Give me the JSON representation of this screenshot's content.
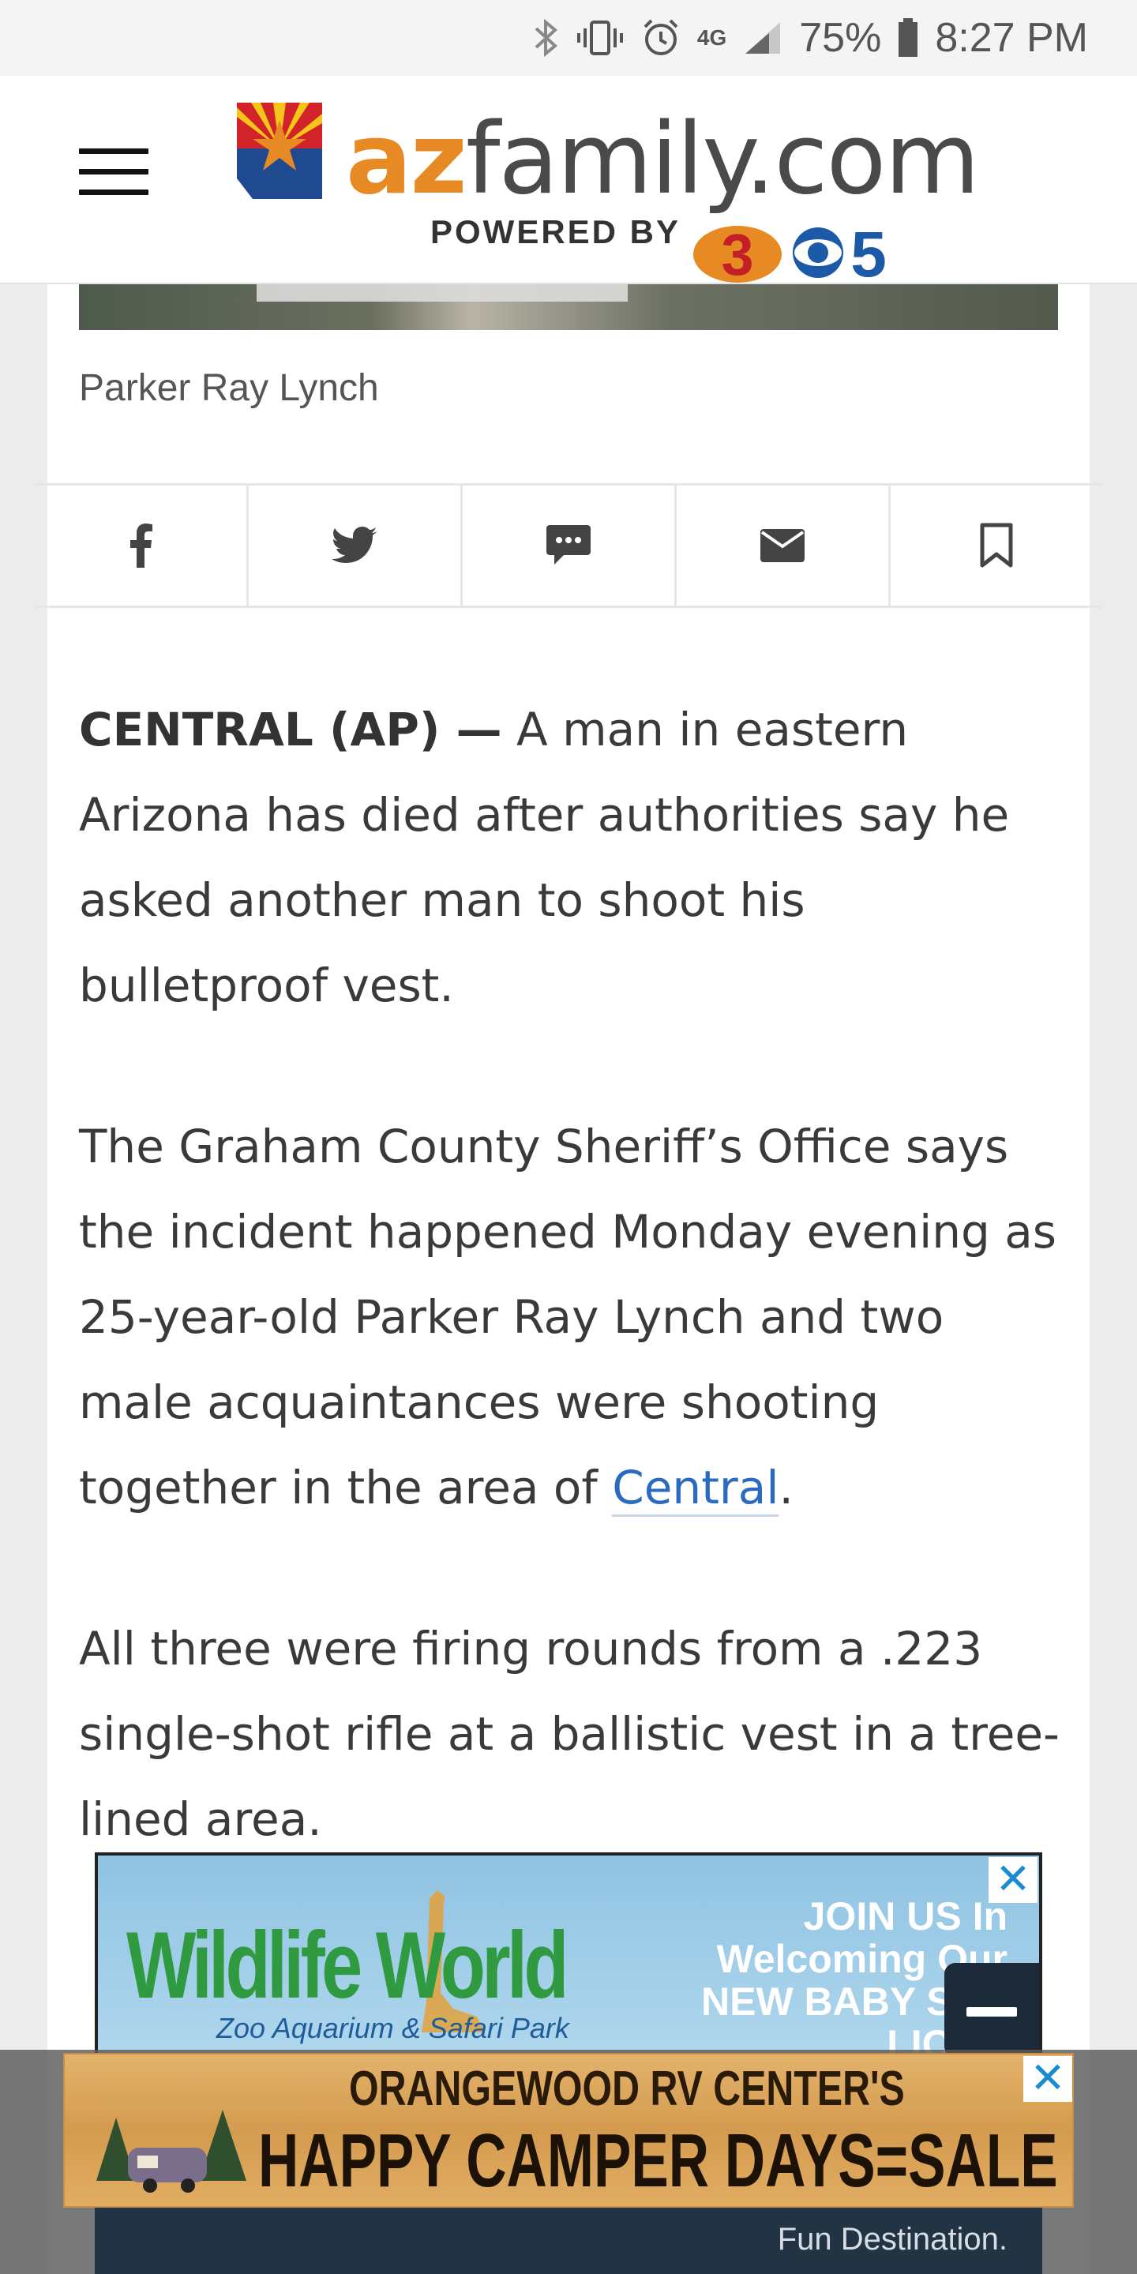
{
  "status_bar": {
    "network": "4G",
    "battery": "75%",
    "time": "8:27 PM"
  },
  "header": {
    "logo_az": "az",
    "logo_family": "family.com",
    "powered_by": "POWERED BY",
    "channel_3": "3",
    "channel_5": "5"
  },
  "article": {
    "photo_caption": "Parker Ray Lynch",
    "share_icons": [
      "facebook-icon",
      "twitter-icon",
      "comment-icon",
      "email-icon",
      "bookmark-icon"
    ],
    "p1_dateline": "CENTRAL (AP) —",
    "p1_text": " A man in eastern Arizona has died after authorities say he asked another man to shoot his bulletproof vest.",
    "p2_text": "The Graham County Sheriff’s Office says the incident happened Monday evening as 25-year-old Parker Ray Lynch and two male acquaintances were shooting together in the area of ",
    "p2_link": "Central",
    "p2_end": ".",
    "p3_text": "All three were firing rounds from a .223 single-shot rifle at a ballistic vest in a tree-lined area."
  },
  "ads": {
    "ad1_brand": "Wildlife World",
    "ad1_sub": "Zoo Aquarium & Safari Park",
    "ad1_message": "JOIN US In Welcoming Our NEW BABY SEA LIONS",
    "ad1_close": "✕",
    "sticky_line1": "ORANGEWOOD RV CENTER'S",
    "sticky_line2": "HAPPY CAMPER DAYS=SALE & EVENT=",
    "sticky_close": "✕",
    "sticky_tail": "Fun Destination."
  },
  "colors": {
    "brand_orange": "#e88a24",
    "link_blue": "#2a6ac0"
  }
}
